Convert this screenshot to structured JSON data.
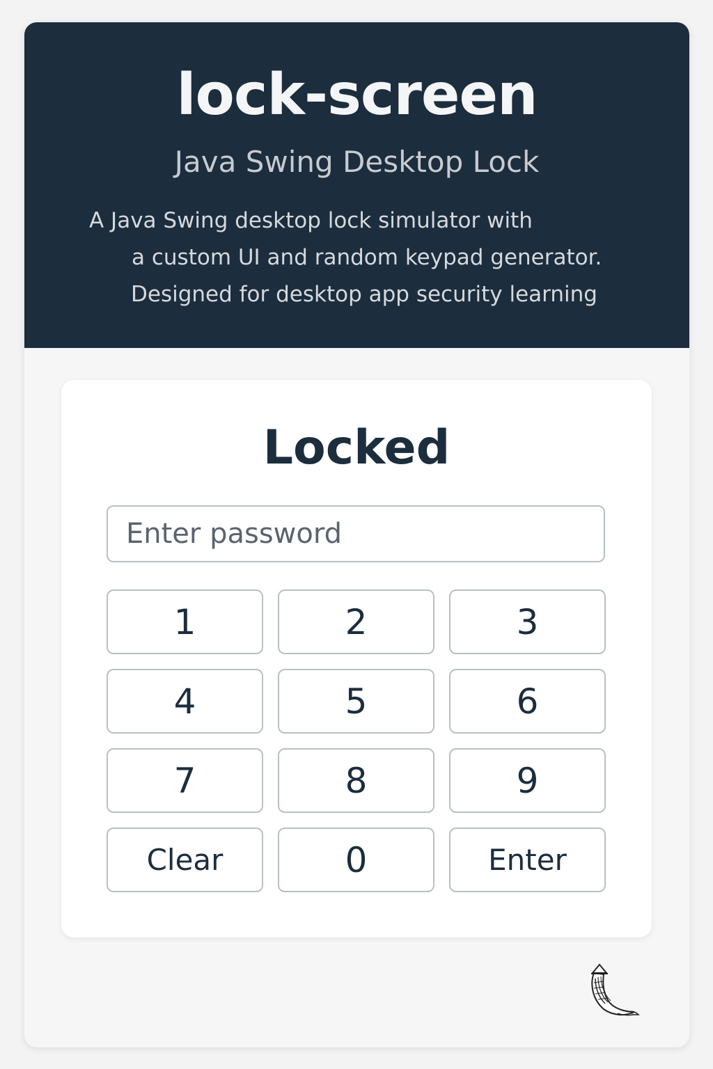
{
  "header": {
    "title": "lock-screen",
    "subtitle": "Java Swing Desktop Lock",
    "description_lines": [
      "A Java Swing desktop lock simulator with",
      "a custom UI and random keypad generator.",
      "Designed for desktop app security learning"
    ]
  },
  "lock_panel": {
    "title": "Locked",
    "password_field": {
      "placeholder": "Enter password",
      "value": ""
    },
    "keypad": [
      "1",
      "2",
      "3",
      "4",
      "5",
      "6",
      "7",
      "8",
      "9",
      "Clear",
      "0",
      "Enter"
    ]
  },
  "icons": {
    "corner": "curled-horn-sketch-icon"
  },
  "colors": {
    "header_background": "#1c2d3d",
    "page_background": "#f6f6f7",
    "card_background": "#ffffff",
    "text_dark": "#1c2d3d",
    "border": "#b9bfc6"
  }
}
